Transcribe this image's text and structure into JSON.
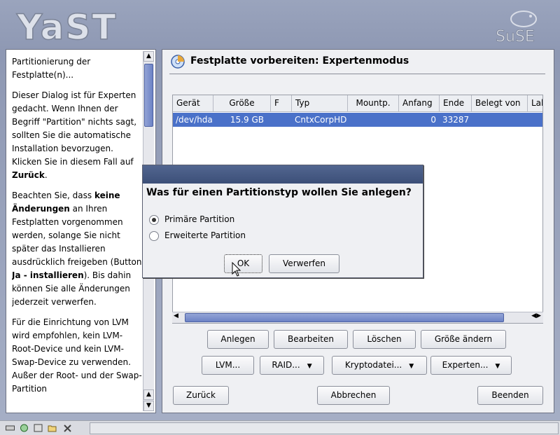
{
  "branding": {
    "logo_text": "YaST",
    "vendor_text": "SuSE"
  },
  "help": {
    "p1": "Partitionierung der Festplatte(n)...",
    "p2_a": "Dieser Dialog ist für Experten gedacht. Wenn Ihnen der Begriff \"Partition\" nichts sagt, sollten Sie die automatische Installation bevorzugen. Klicken Sie in diesem Fall auf ",
    "p2_b": "Zurück",
    "p2_c": ".",
    "p3_a": "Beachten Sie, dass ",
    "p3_b": "keine Änderungen",
    "p3_c": " an Ihren Festplatten vorgenommen werden, solange Sie nicht später das Installieren ausdrücklich freigeben (Button ",
    "p3_d": "Ja - installieren",
    "p3_e": "). Bis dahin können Sie alle Änderungen jederzeit verwerfen.",
    "p4": "Für die Einrichtung von LVM wird empfohlen, kein LVM-Root-Device und kein LVM-Swap-Device zu verwenden. Außer der Root- und der Swap-Partition"
  },
  "main": {
    "title": "Festplatte vorbereiten: Expertenmodus",
    "columns": [
      "Gerät",
      "Größe",
      "F",
      "Typ",
      "Mountp.",
      "Anfang",
      "Ende",
      "Belegt von",
      "Lab"
    ],
    "rows": [
      {
        "device": "/dev/hda",
        "size": "15.9 GB",
        "f": "",
        "type": "CntxCorpHD",
        "mount": "",
        "start": "0",
        "end": "33287",
        "used_by": ""
      }
    ],
    "buttons": {
      "create": "Anlegen",
      "edit": "Bearbeiten",
      "delete": "Löschen",
      "resize": "Größe ändern",
      "lvm": "LVM...",
      "raid": "RAID...",
      "crypto": "Kryptodatei...",
      "expert": "Experten...",
      "back": "Zurück",
      "abort": "Abbrechen",
      "finish": "Beenden"
    }
  },
  "dialog": {
    "question": "Was für einen Partitionstyp wollen Sie anlegen?",
    "options": [
      {
        "label": "Primäre Partition",
        "selected": true
      },
      {
        "label": "Erweiterte Partition",
        "selected": false
      }
    ],
    "ok": "OK",
    "cancel": "Verwerfen"
  },
  "colors": {
    "selection": "#4a71c9",
    "dialog_title": "#3c4f78",
    "background": "#9aa4bd"
  }
}
